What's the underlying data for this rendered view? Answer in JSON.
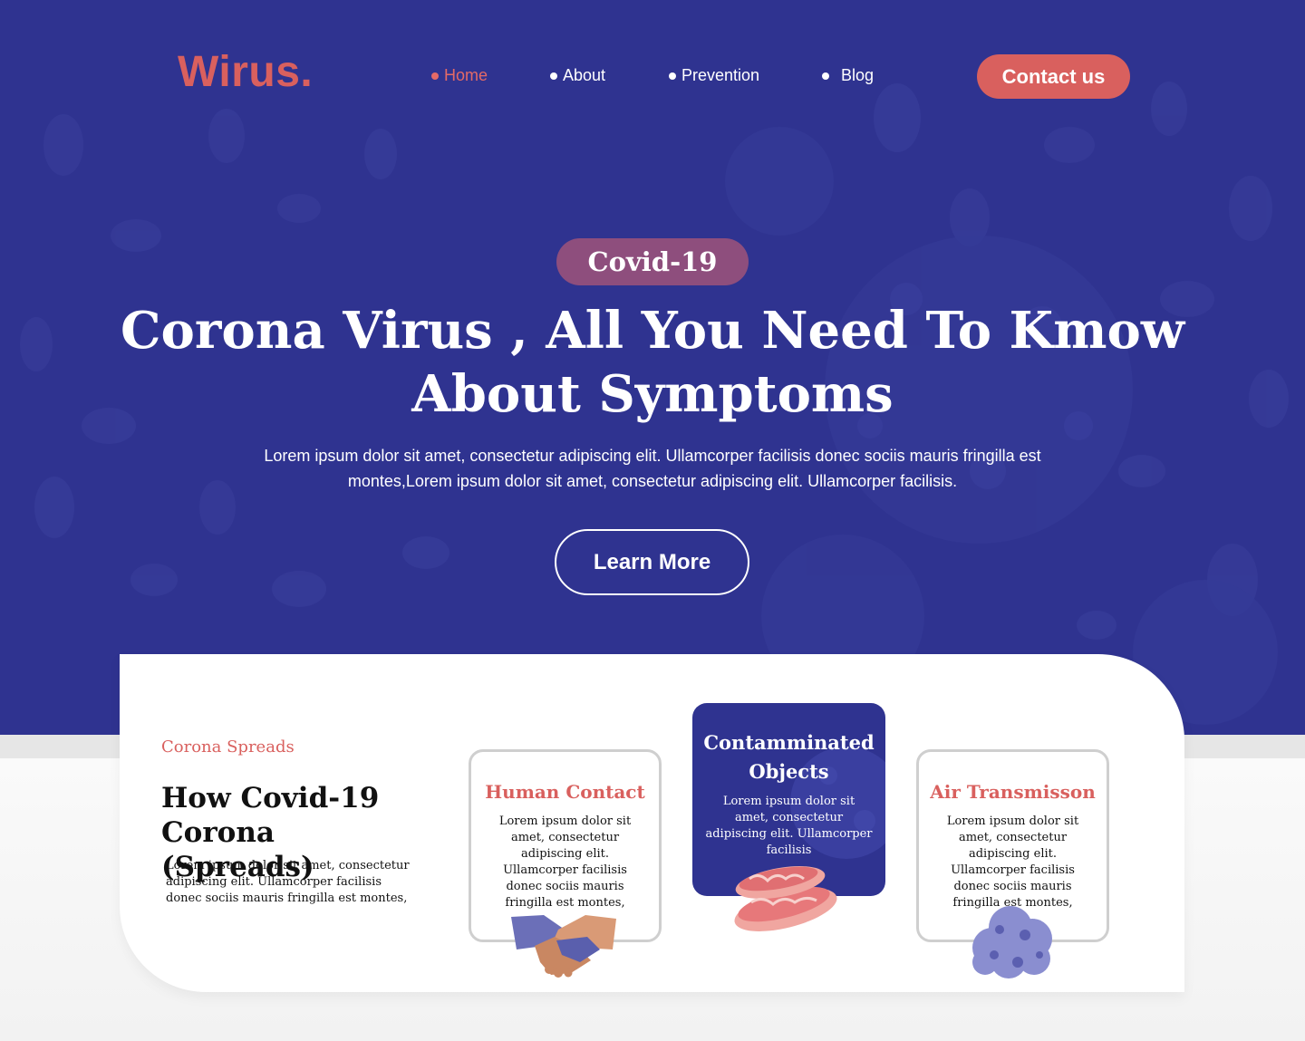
{
  "brand": {
    "logo": "Wirus."
  },
  "nav": {
    "items": [
      {
        "label": "Home",
        "active": true
      },
      {
        "label": "About",
        "active": false
      },
      {
        "label": "Prevention",
        "active": false
      },
      {
        "label": "Blog",
        "active": false
      }
    ],
    "contact_label": "Contact us"
  },
  "hero": {
    "badge": "Covid-19",
    "title_line1": "Corona Virus , All You Need To Kmow",
    "title_line2": "About Symptoms",
    "description": "Lorem ipsum dolor sit amet, consectetur adipiscing elit. Ullamcorper facilisis donec sociis mauris fringilla est montes,Lorem ipsum dolor sit amet, consectetur adipiscing elit. Ullamcorper facilisis.",
    "cta_label": "Learn More"
  },
  "spreads": {
    "eyebrow": "Corona Spreads",
    "title_line1": "How Covid-19",
    "title_line2": "Corona (Spreads)",
    "text": "Lorem ipsum dolor sit amet, consectetur adipiscing elit. Ullamcorper facilisis donec sociis mauris fringilla est montes,",
    "cards": [
      {
        "title": "Human Contact",
        "text": "Lorem ipsum dolor sit amet, consectetur adipiscing elit. Ullamcorper facilisis donec sociis mauris fringilla est montes,",
        "icon": "handshake-icon"
      },
      {
        "title_line1": "Contamminated",
        "title_line2": "Objects",
        "text": "Lorem ipsum dolor sit amet, consectetur adipiscing elit. Ullamcorper facilisis",
        "icon": "contaminated-objects-icon"
      },
      {
        "title": "Air Transmisson",
        "text": "Lorem ipsum dolor sit amet, consectetur adipiscing elit. Ullamcorper facilisis donec sociis mauris fringilla est montes,",
        "icon": "virus-cloud-icon"
      }
    ]
  },
  "colors": {
    "hero_bg": "#2f3390",
    "accent": "#d9605e",
    "badge": "#8e4e7d",
    "card_border": "#cfcfcf"
  }
}
